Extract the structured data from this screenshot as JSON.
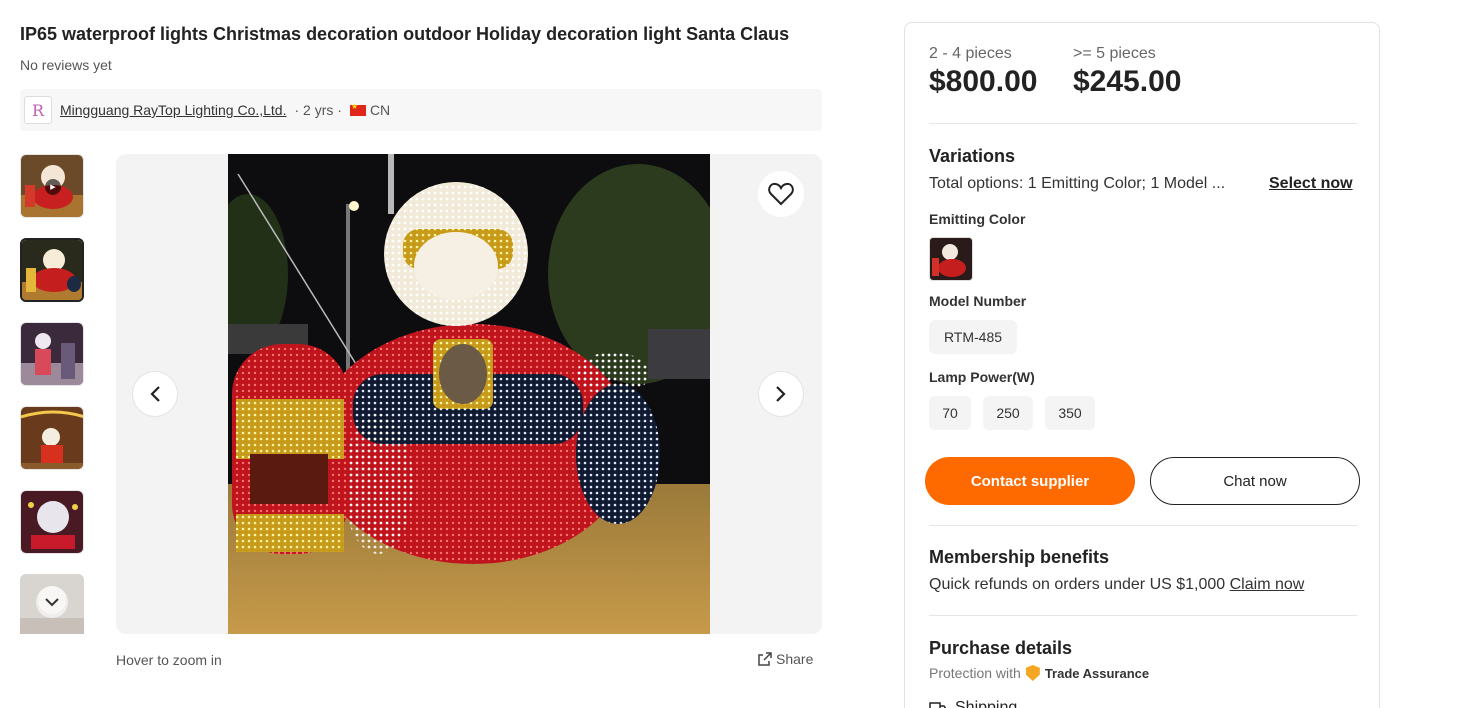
{
  "product": {
    "title": "IP65 waterproof lights Christmas decoration outdoor Holiday decoration light Santa Claus",
    "reviews": "No reviews yet"
  },
  "supplier": {
    "name": "Mingguang RayTop Lighting Co.,Ltd.",
    "years": "· 2 yrs ·",
    "country": "CN"
  },
  "gallery": {
    "hover_hint": "Hover to zoom in",
    "share_label": "Share"
  },
  "pricing": {
    "tiers": [
      {
        "qty": "2 - 4 pieces",
        "price": "$800.00"
      },
      {
        "qty": ">= 5 pieces",
        "price": "$245.00"
      }
    ]
  },
  "variations": {
    "title": "Variations",
    "summary": "Total options: 1 Emitting Color; 1 Model ...",
    "select_label": "Select now",
    "emitting_color_label": "Emitting Color",
    "model_number_label": "Model Number",
    "model_options": [
      "RTM-485"
    ],
    "lamp_power_label": "Lamp Power(W)",
    "lamp_power_options": [
      "70",
      "250",
      "350"
    ]
  },
  "actions": {
    "contact_label": "Contact supplier",
    "chat_label": "Chat now"
  },
  "membership": {
    "title": "Membership benefits",
    "text": "Quick refunds on orders under US $1,000",
    "claim_label": "Claim now"
  },
  "purchase": {
    "title": "Purchase details",
    "protection_prefix": "Protection with",
    "trade_assurance": "Trade Assurance",
    "shipping_label": "Shipping"
  },
  "colors": {
    "accent": "#ff6a00",
    "text": "#222222"
  }
}
